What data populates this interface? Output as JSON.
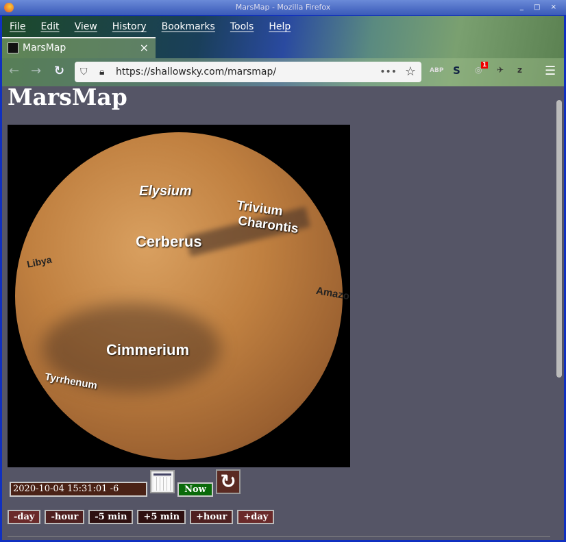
{
  "window": {
    "title": "MarsMap - Mozilla Firefox",
    "controls": "_ □ ×"
  },
  "menu": [
    "File",
    "Edit",
    "View",
    "History",
    "Bookmarks",
    "Tools",
    "Help"
  ],
  "tab": {
    "title": "MarsMap",
    "close": "×"
  },
  "nav": {
    "url": "https://shallowsky.com/marsmap/",
    "more": "•••",
    "badge": "1",
    "ext_abp": "ABP",
    "ext_s": "S"
  },
  "page": {
    "title": "MarsMap",
    "map_labels": {
      "elysium": "Elysium",
      "trivium": "Trivium",
      "charontis": "Charontis",
      "cerberus": "Cerberus",
      "libya": "Libya",
      "amazonis": "Amazo",
      "cimmerium": "Cimmerium",
      "tyrrhenum": "Tyrrhenum"
    },
    "datetime": "2020-10-04 15:31:01 -6",
    "now_label": "Now",
    "steps": [
      {
        "label": "-day",
        "color": "#6a2a2a"
      },
      {
        "label": "-hour",
        "color": "#4e2020"
      },
      {
        "label": "-5 min",
        "color": "#2e1010"
      },
      {
        "label": "+5 min",
        "color": "#2e1010"
      },
      {
        "label": "+hour",
        "color": "#4e2020"
      },
      {
        "label": "+day",
        "color": "#6a2a2a"
      }
    ]
  }
}
